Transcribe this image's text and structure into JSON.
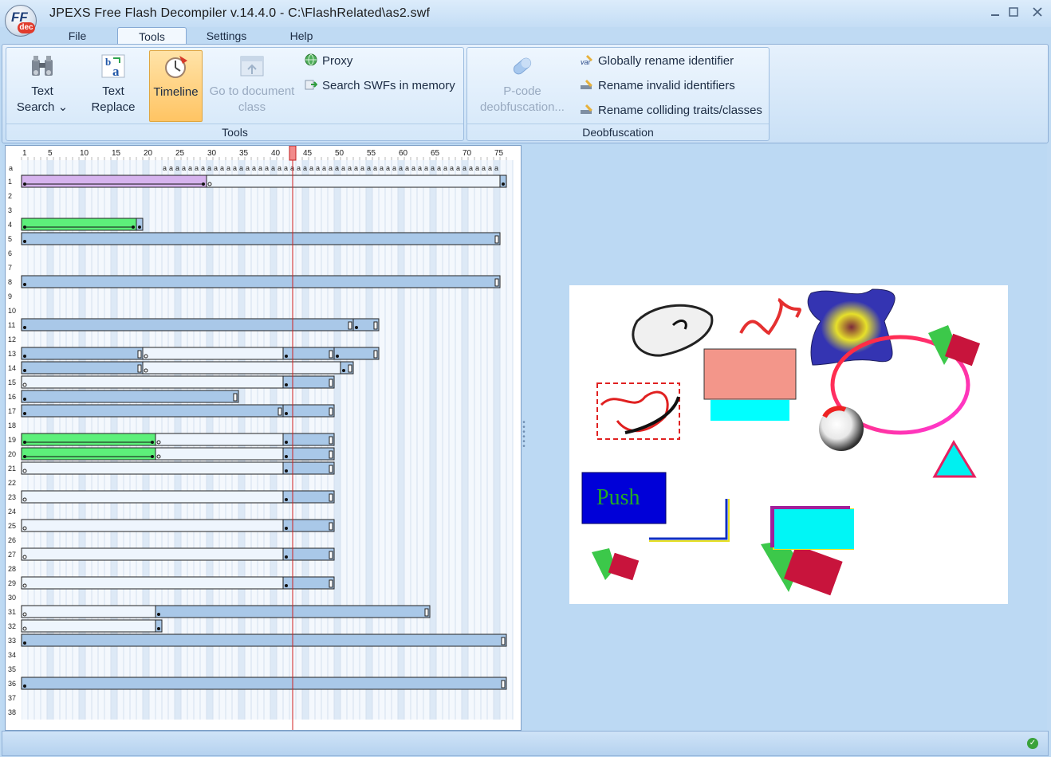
{
  "window": {
    "title": "JPEXS Free Flash Decompiler v.14.4.0 - C:\\FlashRelated\\as2.swf",
    "logo_main": "FF",
    "logo_sub": "dec",
    "minimize_icon": "minimize-icon",
    "maximize_icon": "maximize-icon",
    "close_icon": "close-icon"
  },
  "menu": {
    "tabs": [
      {
        "label": "File",
        "active": false
      },
      {
        "label": "Tools",
        "active": true
      },
      {
        "label": "Settings",
        "active": false
      },
      {
        "label": "Help",
        "active": false
      }
    ]
  },
  "ribbon": {
    "tools_group": {
      "label": "Tools",
      "text_search": {
        "line1": "Text",
        "line2": "Search",
        "dropdown": "⌄",
        "icon": "binoculars-icon"
      },
      "text_replace": {
        "line1": "Text",
        "line2": "Replace",
        "icon": "text-replace-icon"
      },
      "timeline": {
        "label": "Timeline",
        "icon": "timeline-clock-icon",
        "active": true
      },
      "go_to_document_class": {
        "line1": "Go to document",
        "line2": "class",
        "icon": "document-class-icon",
        "enabled": false
      },
      "proxy": {
        "label": "Proxy",
        "icon": "proxy-globe-icon"
      },
      "search_swfs": {
        "label": "Search SWFs in memory",
        "icon": "memory-search-icon"
      }
    },
    "deobfuscation_group": {
      "label": "Deobfuscation",
      "pcode": {
        "line1": "P-code",
        "line2": "deobfuscation...",
        "icon": "pill-icon",
        "enabled": false
      },
      "globally_rename": {
        "label": "Globally rename identifier",
        "icon": "rename-var-icon"
      },
      "rename_invalid": {
        "label": "Rename invalid identifiers",
        "icon": "rename-invalid-icon"
      },
      "rename_colliding": {
        "label": "Rename colliding traits/classes",
        "icon": "rename-colliding-icon"
      }
    }
  },
  "timeline": {
    "frame_ruler": [
      "1",
      "5",
      "10",
      "15",
      "20",
      "25",
      "30",
      "35",
      "40",
      "45",
      "50",
      "55",
      "60",
      "65",
      "70",
      "75"
    ],
    "total_frames": 77,
    "current_frame": 43,
    "action_row_label": "a",
    "action_frames": [
      23,
      75
    ],
    "rows": [
      {
        "label": "1",
        "spans": [
          {
            "from": 1,
            "to": 29,
            "kind": "tween"
          },
          {
            "from": 30,
            "to": 75,
            "kind": "empty"
          },
          {
            "from": 76,
            "to": 76,
            "kind": "key"
          }
        ]
      },
      {
        "label": "2",
        "spans": []
      },
      {
        "label": "3",
        "spans": []
      },
      {
        "label": "4",
        "spans": [
          {
            "from": 1,
            "to": 18,
            "kind": "shape"
          },
          {
            "from": 19,
            "to": 19,
            "kind": "key"
          }
        ]
      },
      {
        "label": "5",
        "spans": [
          {
            "from": 1,
            "to": 75,
            "kind": "key"
          }
        ]
      },
      {
        "label": "6",
        "spans": []
      },
      {
        "label": "7",
        "spans": []
      },
      {
        "label": "8",
        "spans": [
          {
            "from": 1,
            "to": 75,
            "kind": "key"
          }
        ]
      },
      {
        "label": "9",
        "spans": []
      },
      {
        "label": "10",
        "spans": []
      },
      {
        "label": "11",
        "spans": [
          {
            "from": 1,
            "to": 52,
            "kind": "key"
          },
          {
            "from": 53,
            "to": 56,
            "kind": "key"
          }
        ]
      },
      {
        "label": "12",
        "spans": []
      },
      {
        "label": "13",
        "spans": [
          {
            "from": 1,
            "to": 19,
            "kind": "key"
          },
          {
            "from": 20,
            "to": 41,
            "kind": "empty"
          },
          {
            "from": 42,
            "to": 49,
            "kind": "key"
          },
          {
            "from": 50,
            "to": 56,
            "kind": "key"
          }
        ]
      },
      {
        "label": "14",
        "spans": [
          {
            "from": 1,
            "to": 19,
            "kind": "key"
          },
          {
            "from": 20,
            "to": 50,
            "kind": "empty"
          },
          {
            "from": 51,
            "to": 52,
            "kind": "key"
          }
        ]
      },
      {
        "label": "15",
        "spans": [
          {
            "from": 1,
            "to": 41,
            "kind": "empty"
          },
          {
            "from": 42,
            "to": 49,
            "kind": "key"
          }
        ]
      },
      {
        "label": "16",
        "spans": [
          {
            "from": 1,
            "to": 34,
            "kind": "key"
          }
        ]
      },
      {
        "label": "17",
        "spans": [
          {
            "from": 1,
            "to": 41,
            "kind": "key"
          },
          {
            "from": 42,
            "to": 49,
            "kind": "key"
          }
        ]
      },
      {
        "label": "18",
        "spans": []
      },
      {
        "label": "19",
        "spans": [
          {
            "from": 1,
            "to": 21,
            "kind": "shape"
          },
          {
            "from": 22,
            "to": 41,
            "kind": "empty"
          },
          {
            "from": 42,
            "to": 49,
            "kind": "key"
          }
        ]
      },
      {
        "label": "20",
        "spans": [
          {
            "from": 1,
            "to": 21,
            "kind": "shape"
          },
          {
            "from": 22,
            "to": 41,
            "kind": "empty"
          },
          {
            "from": 42,
            "to": 49,
            "kind": "key"
          }
        ]
      },
      {
        "label": "21",
        "spans": [
          {
            "from": 1,
            "to": 41,
            "kind": "empty"
          },
          {
            "from": 42,
            "to": 49,
            "kind": "key"
          }
        ]
      },
      {
        "label": "22",
        "spans": []
      },
      {
        "label": "23",
        "spans": [
          {
            "from": 1,
            "to": 41,
            "kind": "empty"
          },
          {
            "from": 42,
            "to": 49,
            "kind": "key"
          }
        ]
      },
      {
        "label": "24",
        "spans": []
      },
      {
        "label": "25",
        "spans": [
          {
            "from": 1,
            "to": 41,
            "kind": "empty"
          },
          {
            "from": 42,
            "to": 49,
            "kind": "key"
          }
        ]
      },
      {
        "label": "26",
        "spans": []
      },
      {
        "label": "27",
        "spans": [
          {
            "from": 1,
            "to": 41,
            "kind": "empty"
          },
          {
            "from": 42,
            "to": 49,
            "kind": "key"
          }
        ]
      },
      {
        "label": "28",
        "spans": []
      },
      {
        "label": "29",
        "spans": [
          {
            "from": 1,
            "to": 41,
            "kind": "empty"
          },
          {
            "from": 42,
            "to": 49,
            "kind": "key"
          }
        ]
      },
      {
        "label": "30",
        "spans": []
      },
      {
        "label": "31",
        "spans": [
          {
            "from": 1,
            "to": 21,
            "kind": "empty"
          },
          {
            "from": 22,
            "to": 64,
            "kind": "key"
          }
        ]
      },
      {
        "label": "32",
        "spans": [
          {
            "from": 1,
            "to": 21,
            "kind": "empty"
          },
          {
            "from": 22,
            "to": 22,
            "kind": "key"
          }
        ]
      },
      {
        "label": "33",
        "spans": [
          {
            "from": 1,
            "to": 76,
            "kind": "key"
          }
        ]
      },
      {
        "label": "34",
        "spans": []
      },
      {
        "label": "35",
        "spans": []
      },
      {
        "label": "36",
        "spans": [
          {
            "from": 1,
            "to": 76,
            "kind": "key"
          }
        ]
      },
      {
        "label": "37",
        "spans": []
      },
      {
        "label": "38",
        "spans": []
      }
    ],
    "colors": {
      "key": "#a9c8e8",
      "tween": "#d6b3ee",
      "shape": "#5df07a",
      "empty": "#eef5fd",
      "playhead": "#d02020"
    }
  },
  "stage": {
    "push_button_label": "Push"
  },
  "statusbar": {
    "ok_icon": "status-ok-icon",
    "ok_glyph": "✓"
  }
}
